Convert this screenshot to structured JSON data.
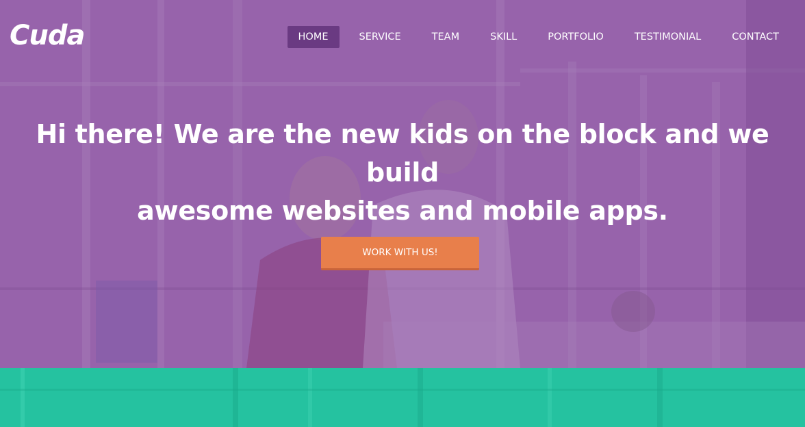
{
  "brand": {
    "logo_text": "Cuda"
  },
  "nav": {
    "items": [
      {
        "label": "HOME",
        "active": true
      },
      {
        "label": "SERVICE",
        "active": false
      },
      {
        "label": "TEAM",
        "active": false
      },
      {
        "label": "SKILL",
        "active": false
      },
      {
        "label": "PORTFOLIO",
        "active": false
      },
      {
        "label": "TESTIMONIAL",
        "active": false
      },
      {
        "label": "CONTACT",
        "active": false
      }
    ]
  },
  "hero": {
    "headline_line1": "Hi there! We are the new kids on the block and we build",
    "headline_line2": "awesome websites and mobile apps.",
    "cta_label": "WORK WITH US!"
  },
  "colors": {
    "hero_overlay": "#9360a8",
    "nav_active_bg": "#6a3a82",
    "cta_bg": "#e87f4b",
    "section_teal": "#25c2a0"
  }
}
